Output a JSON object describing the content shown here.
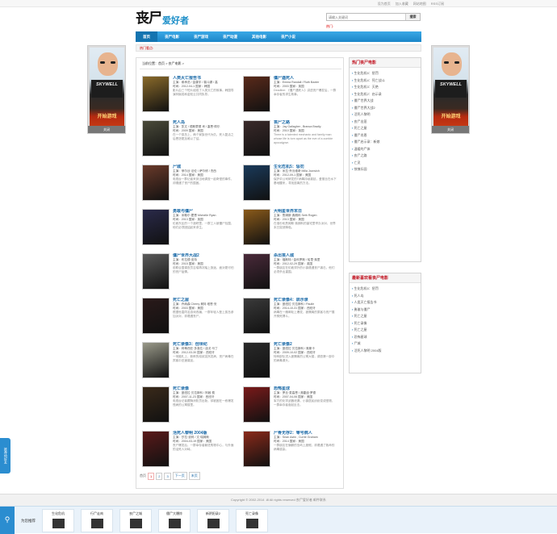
{
  "topbar": {
    "links": [
      "设为首页",
      "加入收藏",
      "网站地图",
      "RSS订阅"
    ]
  },
  "logo": {
    "part1": "丧尸",
    "part2": "爱好者"
  },
  "search": {
    "placeholder": "请输入关键词",
    "button": "搜索"
  },
  "hot_keywords": "热门:",
  "nav": {
    "items": [
      "首页",
      "丧尸电影",
      "丧尸游戏",
      "丧尸动漫",
      "其他电影",
      "丧尸小说"
    ]
  },
  "hotbar": "热门看点:",
  "side_ads": {
    "brand": "SKYWELL",
    "game": "开始游戏",
    "close": "关闭"
  },
  "breadcrumb": "当前位置：首页 > 丧尸电影 >",
  "movies": [
    {
      "title": "人类灭亡报告书",
      "actors": "主演：柳承范 / 金康宇 / 裴斗娜 / 高",
      "meta": "时间：2012-04-1  国家：韩国",
      "desc": "影片由三个短片组成了人类灭亡的故事。韩国导演林弼成和金知云共同执导。",
      "thumb": "#8a6a2a"
    },
    {
      "title": "僵尸遇死人",
      "actors": "主演：Emma Randall / Ruth Baxter",
      "meta": "时间：2003   国家：英国",
      "desc": "Deadline: 《僵尸遇死人》讲述丧尸爆发后，一群幸存者的求生故事。",
      "thumb": "#5a2a1a"
    },
    {
      "title": "死人岛",
      "actors": "主演：凯文 / 德斯蒙德 肖 / 塞恩·佩尔",
      "meta": "时间：2009   国家：美国",
      "desc": "在一个孤岛上，两个家族世代为仇，死人复活之后恩怨更加难以了结。",
      "thumb": "#4a4a3a"
    },
    {
      "title": "丧尸之路",
      "actors": "主演：Jay Gallagher , Branca Bradly",
      "meta": "时间：2010   国家：英国",
      "desc": "There is a talented mechanic and family man whose life is torn apart as the eve of a zombie apocalypse.",
      "thumb": "#3a2a2a"
    },
    {
      "title": "尸城",
      "actors": "主演：菲尔丝·法伦 / 萨尔修 / 杰西",
      "meta": "时间：2014   国家：美国",
      "desc": "电视台一群记者来到当地调查一起奇怪的事件，却遭遇了丧尸的围困。",
      "thumb": "#6a3a2a"
    },
    {
      "title": "生化危机5：惩罚",
      "actors": "主演：米拉·乔沃维奇 Milla Jovovich",
      "meta": "时间：2012-09-1  国家：美国",
      "desc": "保护伞公司研发的T病毒持续蔓延，爱丽丝在水下基地醒来，寻找逃离的方法。",
      "thumb": "#1a3a5a"
    },
    {
      "title": "勇敢与僵尸",
      "actors": "主演：米歇尔·霍恩 Michelle Ryan",
      "meta": "时间：2013   国家：英国",
      "desc": "伦敦东区的一个酒吧里，一群工人被僵尸包围，他们必须团结起来求生。",
      "thumb": "#2a2a4a"
    },
    {
      "title": "大明星世界末日",
      "actors": "主演：詹姆斯·弗朗科 Seth Rogen",
      "meta": "时间：2013   国家：美国",
      "desc": "在洛杉矶詹姆斯·弗朗科的豪宅里举办派对，世界末日突然降临。",
      "thumb": "#8a5a1a"
    },
    {
      "title": "僵尸世界大战2",
      "actors": "主演：布拉德·皮特",
      "meta": "时间：2015   国家：美国",
      "desc": "前联合国调查员吉瑞再次踏上旅途，面对更可怕的丧尸疫情。",
      "thumb": "#5a5a5a"
    },
    {
      "title": "杀出丧人城",
      "actors": "主演：福斯特 / 金科罗斯 / 哈里·弗里",
      "meta": "时间：2012-02-29  国家：英国",
      "desc": "一群朋友在伦敦郊外的小镇遭遇丧尸袭击，他们必须杀出重围。",
      "thumb": "#4a2a3a"
    },
    {
      "title": "死亡之屋",
      "actors": "主演：乔纳森 Cherry 奥特 塔恩·安",
      "meta": "时间：2003   国家：美国",
      "desc": "根据世嘉同名游戏改编，一群年轻人登上孤岛参加派对，却遭遇丧尸。",
      "thumb": "#2a1a1a"
    },
    {
      "title": "死亡录像4：启示录",
      "actors": "主演：曼纽拉·贝拉斯科 / Paulle",
      "meta": "时间：2014-10-31  国家：西班牙",
      "desc": "病毒在一艘邮轮上爆发，被隔离的乘客与丧尸展开殊死搏斗。",
      "thumb": "#3a3a3a"
    },
    {
      "title": "死亡录像3：创世纪",
      "actors": "主演：莉蒂西亚·多洛拉 / 迪戈·马丁",
      "meta": "时间：2012-03-30  国家：西班牙",
      "desc": "一场婚礼上，新郎的叔叔突然发病，丧尸病毒在宾客中迅速蔓延。",
      "thumb": "#9a9a8a"
    },
    {
      "title": "死亡录像2",
      "actors": "主演：曼纽拉·贝拉斯科 / 奥斯卡",
      "meta": "时间：2009-10-02  国家：西班牙",
      "desc": "特种部队进入被隔离的公寓大楼，调查第一部中的病毒源头。",
      "thumb": "#2a2a2a"
    },
    {
      "title": "死亡录像",
      "actors": "主演：曼纽拉·贝拉斯科 / 阿敦·费",
      "meta": "时间：2007-11-23  国家：西班牙",
      "desc": "电视台记者跟随消防员出勤，却被困在一栋爆发怪病的公寓楼里。",
      "thumb": "#3a2a1a"
    },
    {
      "title": "恐怖星球",
      "actors": "主演：罗丝·麦高恩 / 弗雷迪·罗德",
      "meta": "时间：2007-04-06  国家：美国",
      "desc": "军方的化学武器泄漏，小镇居民纷纷变成怪物，一群幸存者奋起反击。",
      "thumb": "#7a1a1a"
    },
    {
      "title": "活死人黎明 2004版",
      "actors": "主演：莎拉·波莉 / 文·瑞姆斯",
      "meta": "时间：2004-03-19  国家：美国",
      "desc": "丧尸爆发后，一群幸存者躲进购物中心，与外面的活死人对峙。",
      "thumb": "#5a1a1a"
    },
    {
      "title": "尸骨无存2：零号病人",
      "actors": "主演：Sean Astin , Currie Graham",
      "meta": "时间：2014   国家：美国",
      "desc": "一群朋友在偏僻的岛屿上度假，却遭遇了致命的病毒感染。",
      "thumb": "#8a2a1a"
    }
  ],
  "pager": {
    "prefix": "首页",
    "pages": [
      "1",
      "2",
      "3"
    ],
    "next": "下一页",
    "last": "末页"
  },
  "sidebar": {
    "hot_title": "热门丧尸电影",
    "hot": [
      "生化危机5：惩罚",
      "生化危机4：死亡战斗",
      "生化危机3：灭绝",
      "生化危机2：启示录",
      "僵尸世界大战",
      "僵尸世界大战2",
      "活死人黎明",
      "丧尸出笼",
      "死亡之屋",
      "僵尸肖恩",
      "僵尸启示录：新娘",
      "温暖的尸体",
      "丧尸之路",
      "亡灵",
      "惊悚乐园"
    ],
    "recent_title": "最新喜欢看丧尸电影",
    "recent": [
      "生化危机5：惩罚",
      "死人岛",
      "人类灭亡报告书",
      "勇敢与僵尸",
      "死亡之屋",
      "死亡录像",
      "死亡之屋",
      "恐怖星球",
      "尸城",
      "活死人黎明 2004版"
    ]
  },
  "footer": "Copyright © 2002-2014 .i8 All rights reserved 丧尸爱好者 邮件联系",
  "bottombar": {
    "label": "为您推荐",
    "items": [
      "生化危机",
      "行尸走肉",
      "丧尸之城",
      "僵尸大爆炸",
      "新阴阳录2",
      "死亡录像"
    ]
  },
  "sidetab": "推荐给好友"
}
